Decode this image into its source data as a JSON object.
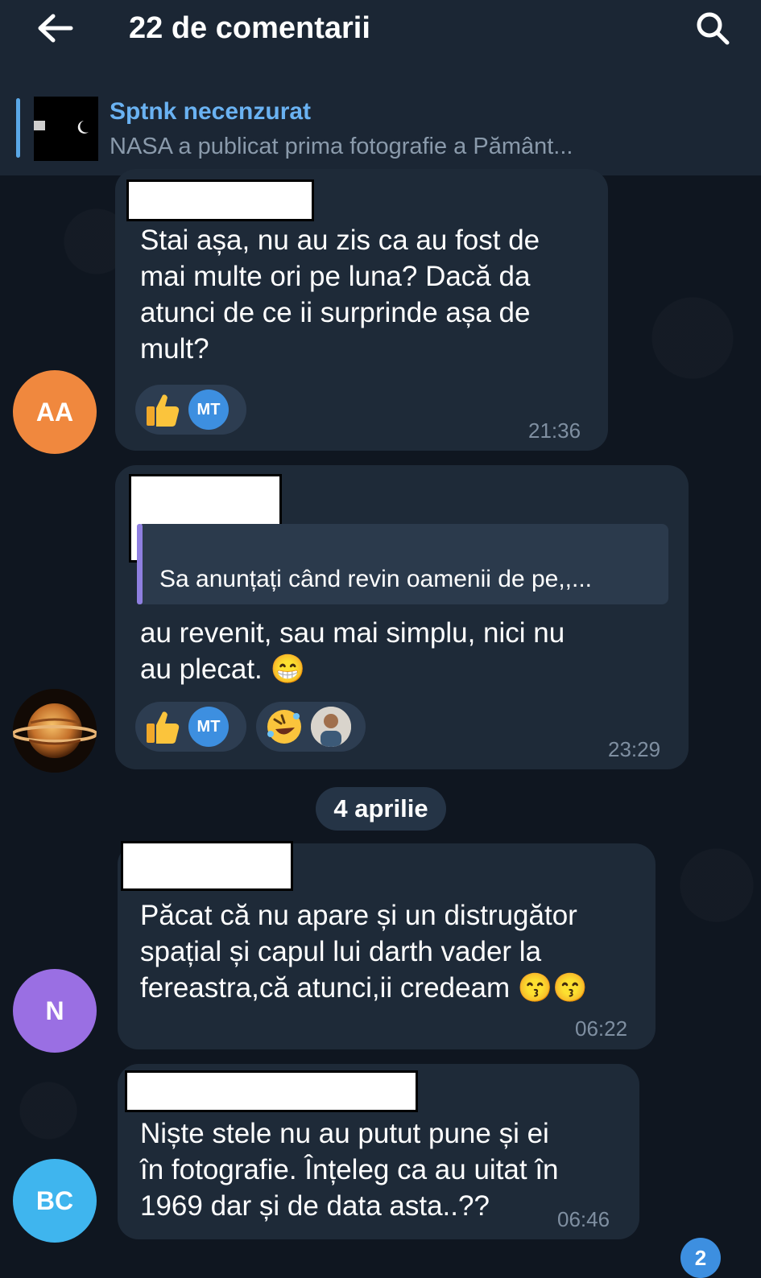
{
  "header": {
    "title": "22 de comentarii",
    "back_icon": "arrow-left-icon",
    "search_icon": "search-icon"
  },
  "pinned": {
    "channel": "Sptnk necenzurat",
    "preview": "NASA a publicat prima fotografie a Pământ..."
  },
  "messages": [
    {
      "avatar_initials": "AA",
      "avatar_color": "#f0883e",
      "text_lines": [
        "Stai așa, nu au zis ca au fost de",
        "mai multe ori pe luna? Dacă da",
        "atunci de ce ii surprinde așa de",
        "mult?"
      ],
      "reactions": [
        {
          "emoji": "thumbs-up-icon",
          "user": "MT"
        }
      ],
      "time": "21:36"
    },
    {
      "avatar_initials": "",
      "avatar_image": "saturn-planet-icon",
      "reply_to": "Sa anunțați când revin oamenii de pe,,...",
      "text_lines": [
        "au revenit, sau mai simplu, nici nu",
        "au plecat. 😁"
      ],
      "reactions": [
        {
          "emoji": "thumbs-up-icon",
          "user": "MT"
        },
        {
          "emoji": "rofl-emoji-icon",
          "user": "user-photo-avatar"
        }
      ],
      "time": "23:29"
    },
    {
      "avatar_initials": "N",
      "avatar_color": "#9a6fe3",
      "text_lines": [
        "Păcat că nu apare și un distrugător",
        "spațial și capul lui darth vader la",
        "fereastra,că atunci,ii credeam 😙😙"
      ],
      "time": "06:22"
    },
    {
      "avatar_initials": "BC",
      "avatar_color": "#3fb5ee",
      "text_lines": [
        "Niște stele nu au putut pune și ei",
        "în fotografie. Înțeleg ca au uitat în",
        "1969 dar și de data asta..??"
      ],
      "time": "06:46"
    }
  ],
  "date_separator": "4 aprilie",
  "scroll_badge": "2"
}
